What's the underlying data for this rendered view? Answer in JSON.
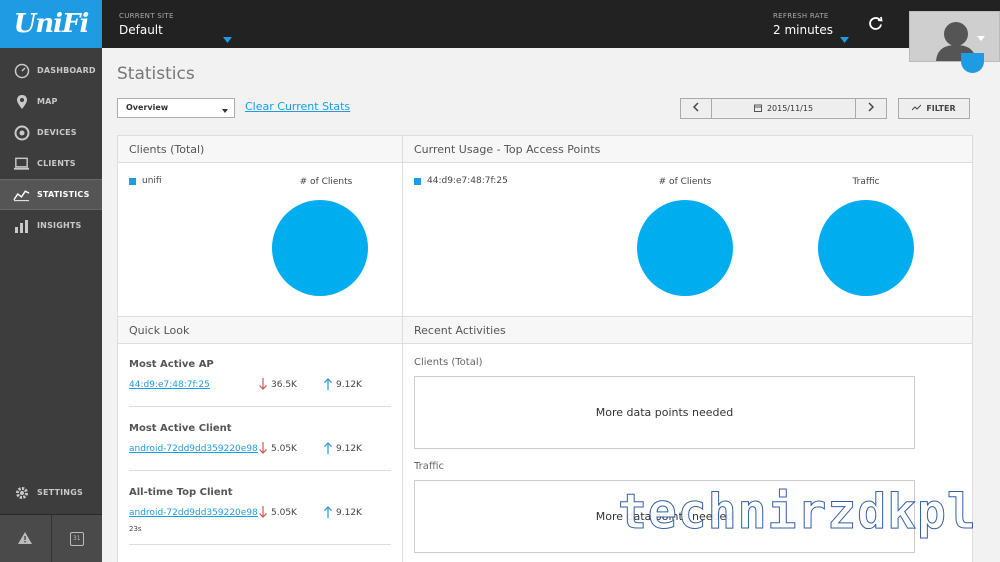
{
  "app": {
    "logo_text": "UniFi",
    "brand_color": "#1e9be3"
  },
  "sidebar": {
    "items": [
      {
        "label": "DASHBOARD",
        "icon": "gauge-icon"
      },
      {
        "label": "MAP",
        "icon": "map-pin-icon"
      },
      {
        "label": "DEVICES",
        "icon": "device-icon"
      },
      {
        "label": "CLIENTS",
        "icon": "laptop-icon"
      },
      {
        "label": "STATISTICS",
        "icon": "line-chart-icon",
        "active": true
      },
      {
        "label": "INSIGHTS",
        "icon": "bar-chart-icon"
      }
    ],
    "settings_label": "SETTINGS",
    "calendar_day": "31"
  },
  "topbar": {
    "site_label": "CURRENT SITE",
    "site_value": "Default",
    "refresh_label": "REFRESH RATE",
    "refresh_value": "2 minutes"
  },
  "main": {
    "title": "Statistics",
    "view_select": "Overview",
    "clear_link": "Clear Current Stats",
    "date": "2015/11/15",
    "filter_label": "FILTER"
  },
  "clients_panel": {
    "title": "Clients (Total)",
    "legend": "unifi",
    "chart_title": "# of Clients"
  },
  "usage_panel": {
    "title": "Current Usage - Top Access Points",
    "legend": "44:d9:e7:48:7f:25",
    "chart1_title": "# of Clients",
    "chart2_title": "Traffic"
  },
  "quick_look": {
    "title": "Quick Look",
    "sections": [
      {
        "title": "Most Active AP",
        "link": "44:d9:e7:48:7f:25",
        "down": "36.5K",
        "up": "9.12K"
      },
      {
        "title": "Most Active Client",
        "link": "android-72dd9dd359220e98",
        "down": "5.05K",
        "up": "9.12K"
      },
      {
        "title": "All-time Top Client",
        "link": "android-72dd9dd359220e98",
        "down": "5.05K",
        "up": "9.12K",
        "sub": "23s"
      }
    ]
  },
  "recent": {
    "title": "Recent Activities",
    "clients_label": "Clients (Total)",
    "clients_msg": "More data points needed",
    "traffic_label": "Traffic",
    "traffic_msg": "More data points needed"
  },
  "watermark": "technirzdkpl"
}
